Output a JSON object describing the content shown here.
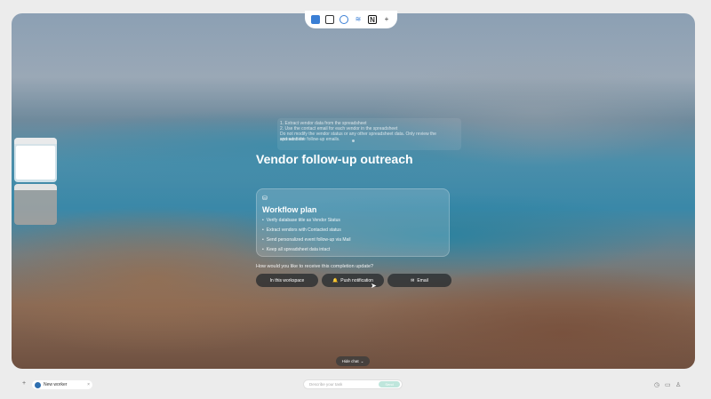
{
  "topbar": {
    "icons": [
      "folder-icon",
      "notes-icon",
      "search-icon",
      "wifi-icon",
      "notion-icon",
      "plus-icon"
    ],
    "plus_label": "+"
  },
  "faded_panel": {
    "line1": "1. Extract vendor data from the spreadsheet",
    "line2": "2. Use the contact email for each vendor in the spreadsheet",
    "line3": "Do not modify the vendor status or any other spreadsheet data. Only review the spreadsheet",
    "line4": "and send the follow-up emails."
  },
  "main": {
    "title": "Vendor follow-up outreach",
    "plan": {
      "icon": "database-icon",
      "heading": "Workflow plan",
      "steps": [
        "Verify database title as Vendor Status",
        "Extract vendors with Contacted status",
        "Send personalized event follow-up via Mail",
        "Keep all spreadsheet data intact"
      ]
    },
    "question": "How would you like to receive this completion update?",
    "options": [
      {
        "label": "In this workspace",
        "icon": "workspace-icon"
      },
      {
        "label": "Push notification",
        "icon": "bell-icon"
      },
      {
        "label": "Email",
        "icon": "mail-icon"
      }
    ],
    "hide_chat": "Hide chat"
  },
  "bottom": {
    "worker_label": "New worker",
    "input_placeholder": "Describe your task",
    "send_label": "Send"
  }
}
